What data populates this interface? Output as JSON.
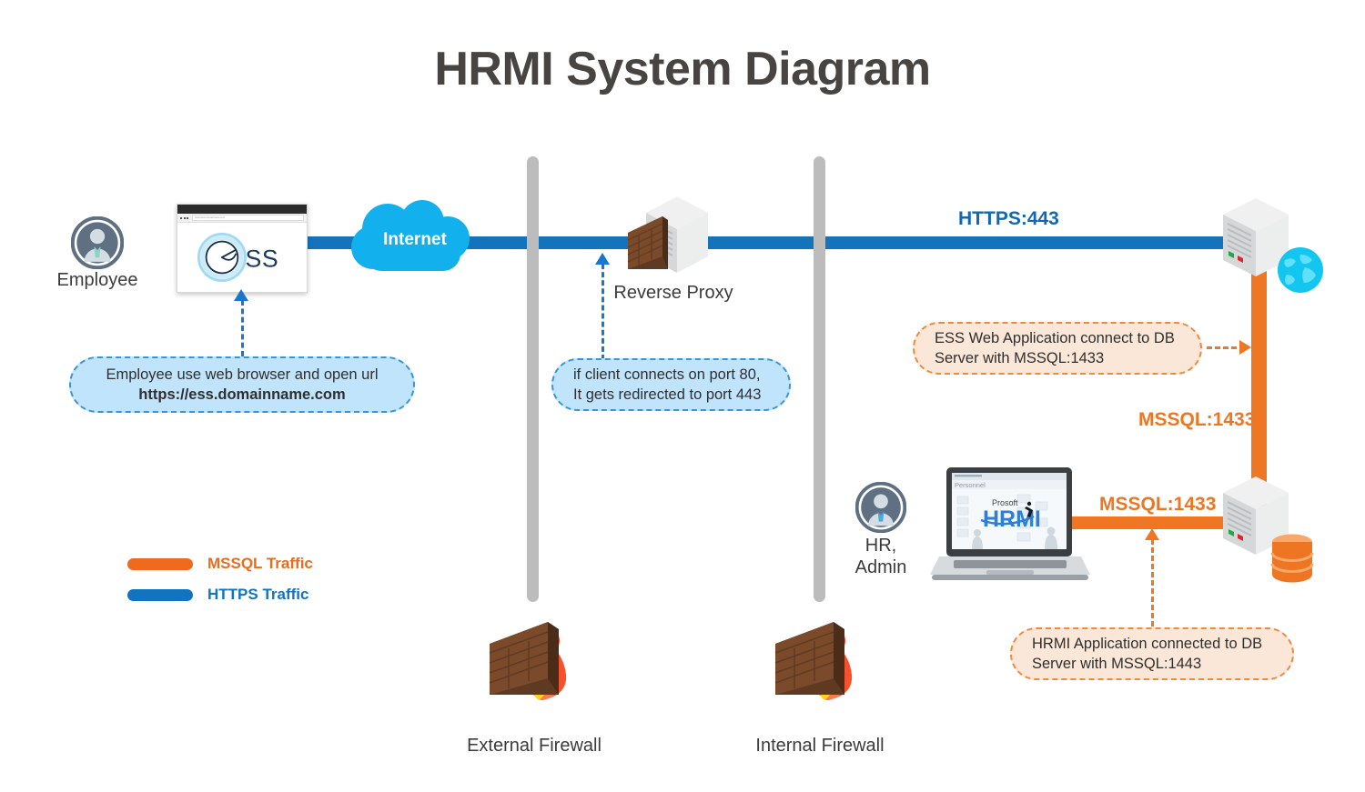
{
  "title": "HRMI System Diagram",
  "nodes": {
    "employee": {
      "label": "Employee",
      "icon": "employee-avatar-icon"
    },
    "browser": {
      "url": "https://ess.domainname.com",
      "logo_text": "SS",
      "logo_mark": "e"
    },
    "internet": {
      "label": "Internet",
      "icon": "cloud-icon",
      "color": "#12b0ed"
    },
    "reverse_proxy": {
      "label": "Reverse Proxy",
      "icon": "server-brick-icon"
    },
    "external_firewall": {
      "label": "External Firewall",
      "icon": "firewall-icon"
    },
    "internal_firewall": {
      "label": "Internal Firewall",
      "icon": "firewall-icon"
    },
    "hr_admin": {
      "label": "HR,\nAdmin",
      "line1": "HR,",
      "line2": "Admin",
      "icon": "hr-avatar-icon"
    },
    "laptop": {
      "icon": "laptop-icon",
      "screen_app_brand": "Prosoft",
      "screen_app_name": "HRMI",
      "screen_menu": "Personnel"
    },
    "web_server": {
      "icon": "server-globe-icon"
    },
    "db_server": {
      "icon": "server-database-icon"
    }
  },
  "links": {
    "https_443": "HTTPS:443",
    "mssql_1433_vertical": "MSSQL:1433",
    "mssql_1433_horizontal": "MSSQL:1433"
  },
  "callouts": {
    "employee_browser": {
      "line1": "Employee use web browser and open url",
      "line2": "https://ess.domainname.com"
    },
    "port_redirect": {
      "line1": "if client connects on port 80,",
      "line2": "It gets redirected to port 443"
    },
    "ess_db": {
      "line1": "ESS Web Application connect to DB",
      "line2": "Server with MSSQL:1433"
    },
    "hrmi_db": {
      "line1": "HRMI Application connected to DB",
      "line2": "Server with MSSQL:1443"
    }
  },
  "legend": {
    "items": [
      {
        "label": "MSSQL Traffic",
        "color": "#ee6a1c"
      },
      {
        "label": "HTTPS Traffic",
        "color": "#1273bf"
      }
    ]
  },
  "colors": {
    "https_blue": "#1473ba",
    "mssql_orange": "#ef7622",
    "cloud_cyan": "#12b0ed",
    "title_gray": "#474442",
    "divider_gray": "#bcbcbc",
    "callout_blue_bg": "#bfe4fb",
    "callout_blue_border": "#3a94d8",
    "callout_orange_bg": "#fbe7d8",
    "callout_orange_border": "#ef8a3d"
  }
}
